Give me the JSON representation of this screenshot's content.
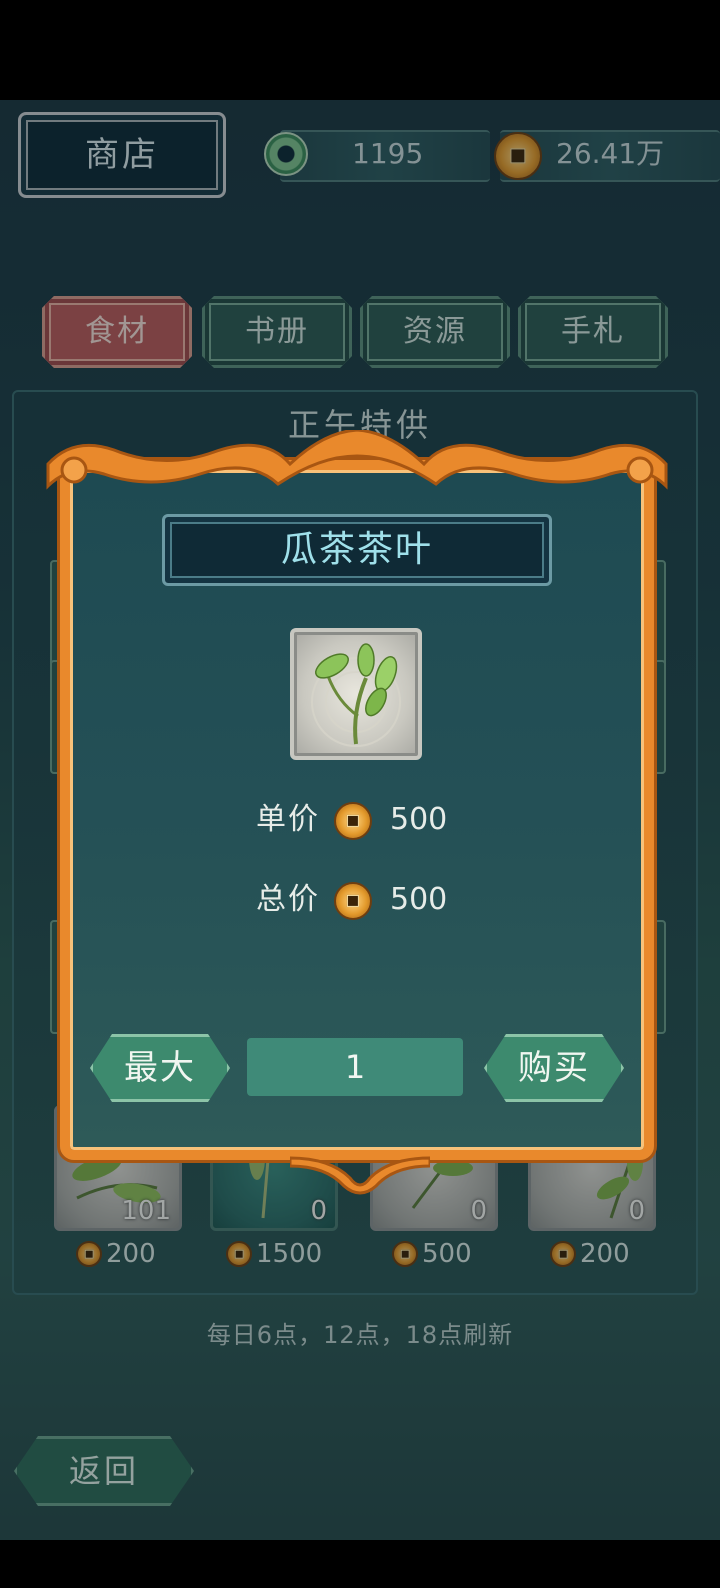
{
  "topbar": {
    "title": "商店",
    "jade_amount": "1195",
    "coin_amount": "26.41万",
    "colors": {
      "jade": "#7ec08c",
      "coin": "#e39a2c"
    }
  },
  "tabs": [
    {
      "label": "食材",
      "active": true
    },
    {
      "label": "书册",
      "active": false
    },
    {
      "label": "资源",
      "active": false
    },
    {
      "label": "手札",
      "active": false
    }
  ],
  "shop": {
    "section_title": "正午特供",
    "items": [
      {
        "count": "101",
        "price": "200"
      },
      {
        "count": "0",
        "price": "1500"
      },
      {
        "count": "0",
        "price": "500"
      },
      {
        "count": "0",
        "price": "200"
      }
    ],
    "refresh_note": "每日6点，12点，18点刷新"
  },
  "back_label": "返回",
  "dialog": {
    "item_name": "瓜茶茶叶",
    "item_icon": "tea-leaf-icon",
    "unit_price_label": "单价",
    "unit_price": "500",
    "total_price_label": "总价",
    "total_price": "500",
    "max_label": "最大",
    "quantity": "1",
    "buy_label": "购买",
    "frame_color": "#e9892c"
  }
}
